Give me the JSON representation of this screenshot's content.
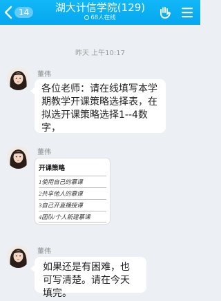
{
  "header": {
    "back_count": "14",
    "title": "湖大计信学院(129)",
    "online": "68人在线"
  },
  "chat": {
    "timestamp": "昨天 上午10:17",
    "messages": [
      {
        "sender": "董伟",
        "text": "各位老师：请在线填写本学期教学开课策略选择表，在拟选开课策略选择1--4数字，",
        "type": "text"
      },
      {
        "sender": "董伟",
        "type": "image",
        "image": {
          "title": "开课策略",
          "rows": [
            "1使用自己的慕课",
            "2共享他人的慕课",
            "3自己开直播授课",
            "4团队/个人新建慕课"
          ]
        }
      },
      {
        "sender": "董伟",
        "text": "如果还是有困难，也可写清楚。请在今天填完。",
        "type": "text"
      }
    ]
  },
  "colors": {
    "header_bg": "#0aaff2",
    "chat_bg": "#eceff3",
    "bubble_bg": "#ffffff"
  },
  "icons": [
    "back-arrow-icon",
    "online-dot-icon",
    "hand-wave-icon",
    "menu-icon"
  ]
}
